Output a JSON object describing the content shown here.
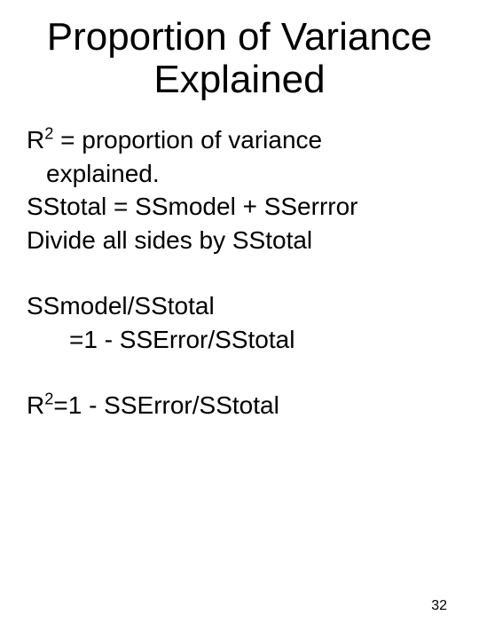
{
  "title_line1": "Proportion of Variance",
  "title_line2": "Explained",
  "para1_prefix": "R",
  "para1_sup": "2",
  "para1_rest": " =  proportion of variance",
  "para1_cont": "explained.",
  "line_sstotal": "SStotal = SSmodel + SSerrror",
  "line_divide": "Divide all sides by SStotal",
  "line_ratio1": "SSmodel/SStotal",
  "line_ratio2": "=1 -  SSError/SStotal",
  "final_prefix": "R",
  "final_sup": "2",
  "final_rest": "=1 -  SSError/SStotal",
  "page_number": "32"
}
